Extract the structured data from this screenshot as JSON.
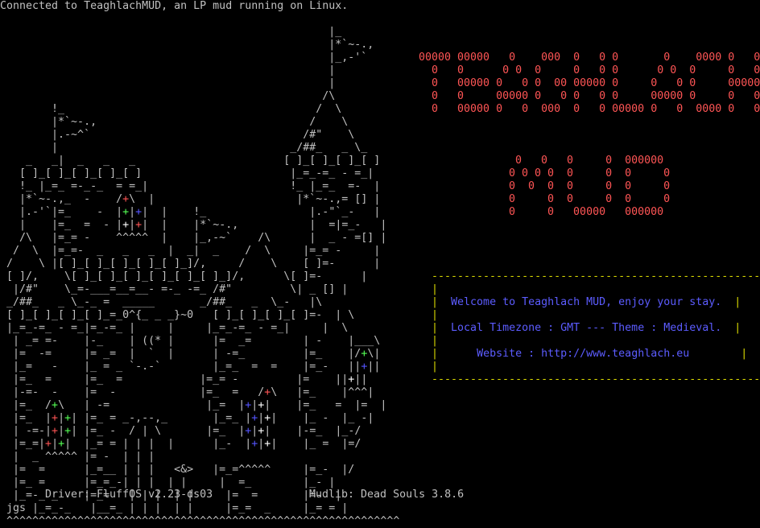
{
  "terminal": {
    "connect_message": "Connected to TeaghlachMUD, an LP mud running on Linux.",
    "banner_lines_top": [
      "00000 00000   0    000  0   0 0       0    0000 0   0",
      "  0   0      0 0  0     0   0 0      0 0  0     0   0",
      "  0   00000 0   0 0  00 00000 0     0   0 0     00000",
      "  0   0     00000 0   0 0   0 0     00000 0     0   0",
      "  0   00000 0   0  000  0   0 00000 0   0  0000 0   0"
    ],
    "banner_lines_bottom": [
      " 0   0   0     0  000000",
      "0 0 0 0  0     0  0     0",
      "0  0  0  0     0  0     0",
      "0     0  0     0  0     0",
      "0     0   00000   000000"
    ],
    "welcome": {
      "line1": "Welcome to Teaghlach MUD, enjoy your stay.",
      "line2": "Local Timezone : GMT --- Theme : Medieval.",
      "line3": "Website : http://www.teaghlach.eu"
    },
    "castle_art": [
      "                                                  |_",
      "                                                  |*`~-.,",
      "                                                  |_,-'`",
      "                                                  |",
      "                                                  |",
      "                                                 /\\",
      "       !_                                       /  \\",
      "       |*`~-.,                                 /    \\",
      "       |.-~^`                                 /#\"    \\",
      "       |                                    _/##_   _ \\_",
      "   _   _|  _   _   _                       [ ]_[ ]_[ ]_[ ]",
      "  [ ]_[ ]_[ ]_[ ]_[ ]                       |_=_-=_ - =_|",
      "  !_ |_=_ =-_-_  = =_|                      !_ |_=_  =-  |",
      "  |*`~-.,_  -    /+\\  |                      |*`~-.,= [] |",
      "  |.-'`|=_    -  |+|+|  |    !_                |.-\"`_-   |",
      "  |    |=_  =  - |+|+|  |    |*`~-.,           |  =|=_-   |",
      "  /\\   |=_= -    ^^^^^  |    |_,-~`    /\\      |  _ - =[] |",
      " /  \\  |=_=-  _   _   _  |  _|  _    /  \\     |=_= -     |",
      "/    \\ |[ ]_[ ]_[ ]_[ ]_[ ]_]/,     /    \\    [ ]=-      |",
      "[ ]/,    \\[ ]_[ ]_[ ]_[ ]_[ ]_[ ]_]/,      \\[ ]=-      |",
      " |/#\"    \\_=-___=__=__- =-_ -=_ /#\"         \\| _ [] |",
      "_/##_   _ \\_-_ =  _____       _/##_   _  \\_-   |\\",
      "[ ]_[ ]_[ ]_[ ]_=_0^{_ _ _}~0   [ ]_[ ]_[ ]_[ ]=-  | \\",
      "|_=_-=_ - =_|=_-=_ |     |     |_=_-=_ - =_|     |  \\",
      " | _= =-    |-_    | ((* |      |=  _=        | -    |___\\",
      " |=  -=     |= _=  |  `  |      | -=_         |=_    |/+\\|",
      " |_=   -    |_ = _ `-.-`        |_=_  =  =    |=_-   ||+||",
      " |=_  =     |=_  =            |=_= -         |=    ||+||",
      " |-=-  -    |=  -             |=_  =   /+\\   |=_    |^^^|",
      " |=_  /+\\   | -=               |_=  |+|+|    |=_   =  |=  |",
      " |=_  |+|+| |=_ = _-,--,_       |_=_ |+|+|    |_ -  |_ -|",
      " | -=-|+|+| |=_ -  / | \\       |=_  |+|+|    |-=_  |_-/",
      " |=_=|+|+|  |_= = | | |  |      |_-  |+|+|    |_ =  |=/",
      " |  _ ^^^^^ |= -  | | | ",
      " |=  =      |_=__ | | |   <&>   |=_=^^^^^     |=_-  |/",
      " |=_ =      |=_=_-| | |  | |     |  =_        |_- |",
      " |_=-_ _    |=_=   | | |  | |     |=  =       |=-  |",
      "jgs |_=_-_   |__=_ | | |  | |     |=_=  _     |_= = |",
      "^^^^^^^^^^^^^^^^^^^^^^^^^^^^^^^^^^^^^^^^^^^^^^^^^^^^^^^^^^^^^"
    ],
    "footer": {
      "driver": "Driver: FluffOS v2.23-ds03",
      "mudlib": "Mudlib: Dead Souls 3.8.6"
    },
    "colors": {
      "background": "#000000",
      "text": "#c0c0c0",
      "banner": "#ff5555",
      "welcome_text": "#5c5cff",
      "box_border": "#d7d700"
    }
  }
}
